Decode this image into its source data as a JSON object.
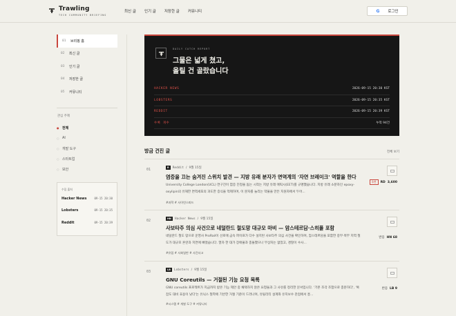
{
  "brand": {
    "name": "Trawling",
    "tagline": "TECH COMMUNITY BRIEFING"
  },
  "nav": [
    "최신 글",
    "인기 글",
    "저장한 글",
    "커뮤니티"
  ],
  "login": {
    "icon": "G",
    "label": "로그인"
  },
  "sidebar": {
    "items": [
      {
        "num": "01",
        "label": "브리핑 홈"
      },
      {
        "num": "02",
        "label": "최신 글"
      },
      {
        "num": "03",
        "label": "인기 글"
      },
      {
        "num": "04",
        "label": "저장한 글"
      },
      {
        "num": "05",
        "label": "커뮤니티"
      }
    ],
    "topics_label": "관심 주제",
    "topics": [
      "전체",
      "AI",
      "개발 도구",
      "스타트업",
      "보안"
    ],
    "log_title": "수집 출처",
    "log": [
      {
        "source": "Hacker News",
        "time": "09-15 20:30"
      },
      {
        "source": "Lobsters",
        "time": "09-15 20:35"
      },
      {
        "source": "Reddit",
        "time": "09-15 20:39"
      }
    ]
  },
  "hero": {
    "kicker": "DAILY CATCH REPORT",
    "line1": "그물은 넓게 쳤고,",
    "line2": "올릴 건 골랐습니다",
    "rows": [
      {
        "name": "HACKER NEWS",
        "time": "2026-09-15 20:30 KST"
      },
      {
        "name": "LOBSTERS",
        "time": "2026-09-15 20:35 KST"
      },
      {
        "name": "REDDIT",
        "time": "2026-09-15 20:39 KST"
      },
      {
        "name": "수록 개수",
        "time": "누적 94건"
      }
    ]
  },
  "feed": {
    "title": "방금 건진 글",
    "all": "전체 보기",
    "posts": [
      {
        "num": "01",
        "badge": "R",
        "source": "Reddit",
        "date": "9월 15일",
        "title": "염증을 끄는 숨겨진 스위치 발견 — 지방 유래 분자가 면역계의 '자연 브레이크' 역할을 한다",
        "summary": "University College London(UCL) 연구진이 염증 진정을 돕는 시작는 지방 유래 에픽시(EET)를 규명했습니다. 지방 유래 소분자인 epoxy-oxylipin의 유해한 면역세포의 과도한 증식을 억제하며, 이 분자를 늘리는 약물을 만든 지원자에서 두어...",
        "tags": "#과학  # 사이언스피드",
        "hot": "추천",
        "stat_label": "RD",
        "stat_value": "3,600"
      },
      {
        "num": "02",
        "badge": "HN",
        "source": "Hacker News",
        "date": "9월 15일",
        "title": "사보타주 의심 사건으로 네덜란드 철도망 대규모 마비 — 암스테르담·스히폴 포함",
        "summary": "네덜란드 철도 망으로 운영사 ProRail이 선로에 금속 파이프가 다수 설치된 사보타주 의심 사건을 확인하며, 암스테르담을 포함한 중부·북부 지역 철도가 대규모 혼란과 지연에 빠졌습니다. 열차 한 대가 장애물과 충돌했으나 부상자는 없었고, 경찰이 수사...",
        "tags": "#유럽  # 사회일반  # 사건사고",
        "hot": "",
        "stat_label": "반응",
        "stat_value": "HN 68"
      },
      {
        "num": "03",
        "badge": "LB",
        "source": "Lobsters",
        "date": "9월 15일",
        "title": "GNU Coreutils — 거절된 기능 요청 목록",
        "summary": "GNU coreutils 프로젝트가 지금까지 받은 기능 제안 중 채택하지 않은 요청들과 그 사유를 정리한 문서입니다. '기본 조각 조합으로 충분하다', '복잡도 대비 효용이 낮다'는 유닉스 철학에 기반한 거절 기준이 드러나며, 유틸리티 설계와 유지보수 관점에서 흥...",
        "tags": "#시스템  # 개발 도구  # 커뮤니티",
        "hot": "",
        "stat_label": "반응",
        "stat_value": "LB 9"
      }
    ]
  }
}
